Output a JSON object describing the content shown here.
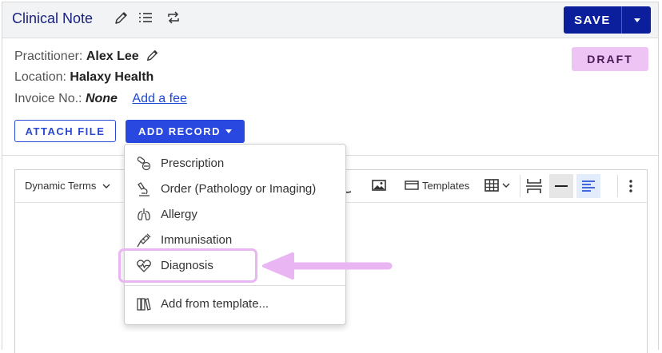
{
  "header": {
    "title": "Clinical Note",
    "save_label": "SAVE",
    "icons": [
      "pencil-icon",
      "list-icon",
      "repeat-icon"
    ]
  },
  "details": {
    "practitioner_label": "Practitioner:",
    "practitioner_value": "Alex Lee",
    "location_label": "Location:",
    "location_value": "Halaxy Health",
    "invoice_label": "Invoice No.:",
    "invoice_value": "None",
    "add_fee_link": "Add a fee",
    "status_badge": "DRAFT"
  },
  "actions": {
    "attach_file": "ATTACH FILE",
    "add_record": "ADD RECORD"
  },
  "toolbar": {
    "dynamic_terms": "Dynamic Terms",
    "templates": "Templates"
  },
  "menu": {
    "items": [
      {
        "label": "Prescription",
        "icon": "pills-icon"
      },
      {
        "label": "Order (Pathology or Imaging)",
        "icon": "microscope-icon"
      },
      {
        "label": "Allergy",
        "icon": "lungs-icon"
      },
      {
        "label": "Immunisation",
        "icon": "syringe-icon"
      },
      {
        "label": "Diagnosis",
        "icon": "heart-pulse-icon"
      }
    ],
    "template_item": {
      "label": "Add from template...",
      "icon": "books-icon"
    }
  },
  "colors": {
    "primary": "#2948e0",
    "save": "#0b1f9c",
    "title": "#1a237e",
    "draft_bg": "#edc4f4",
    "highlight": "#e9b5f2"
  }
}
